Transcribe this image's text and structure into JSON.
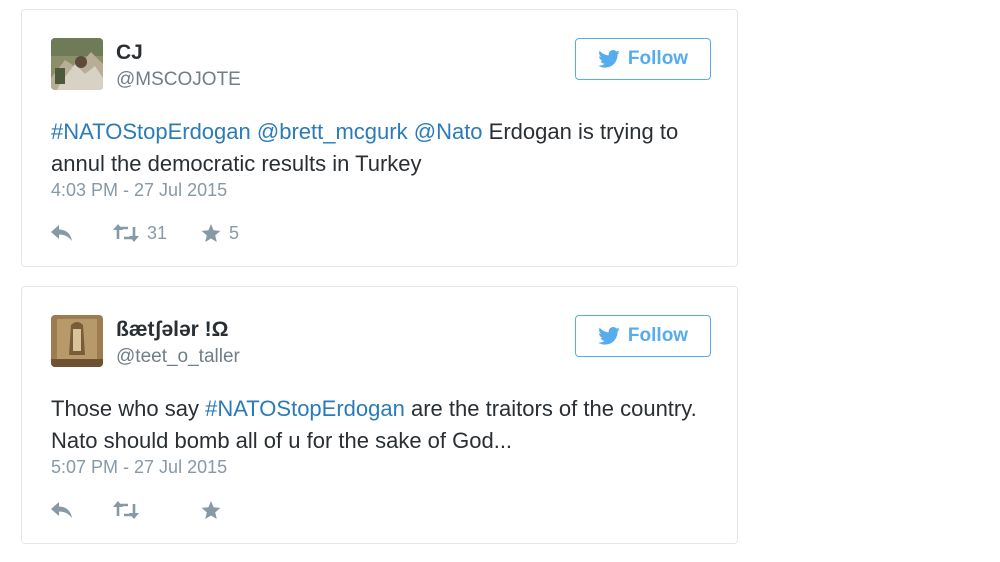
{
  "colors": {
    "link": "#2b7bb9",
    "follow_accent": "#55acee",
    "muted": "#8899a6",
    "border": "#e1e8ed"
  },
  "tweets": [
    {
      "display_name": "CJ",
      "screen_name": "@MSCOJOTE",
      "follow_label": "Follow",
      "text": {
        "hashtag": "#NATOStopErdogan",
        "mention1": "@brett_mcgurk",
        "mention2": "@Nato",
        "body": "Erdogan is trying to annul the democratic results in Turkey"
      },
      "timestamp": "4:03 PM - 27 Jul 2015",
      "retweets": "31",
      "favorites": "5"
    },
    {
      "display_name": "ßætʃələr !Ω",
      "screen_name": "@teet_o_taller",
      "follow_label": "Follow",
      "text": {
        "before": "Those who say",
        "hashtag": "#NATOStopErdogan",
        "after": "are the traitors of the country. Nato should bomb all of u for the sake of God..."
      },
      "timestamp": "5:07 PM - 27 Jul 2015",
      "retweets": "",
      "favorites": ""
    }
  ],
  "icons": {
    "follow": "twitter-bird-icon",
    "reply": "reply-icon",
    "retweet": "retweet-icon",
    "favorite": "star-icon"
  }
}
